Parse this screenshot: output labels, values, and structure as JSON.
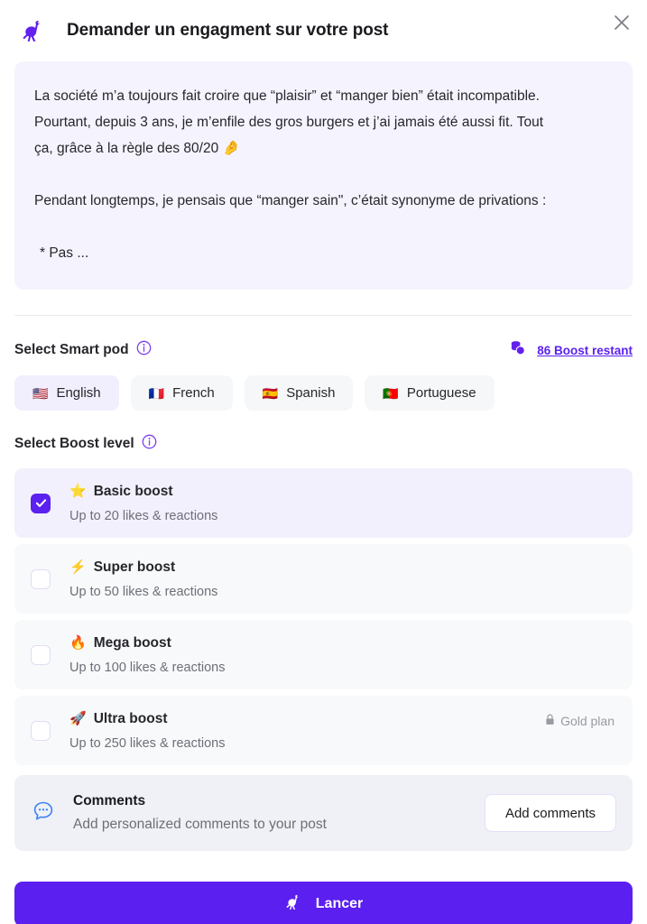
{
  "header": {
    "logo_icon": "ostrich-logo",
    "title": "Demander un engagment sur votre post",
    "close_icon": "close-icon"
  },
  "post_preview": {
    "paragraph_1_line_1": "La société m’a toujours fait croire que “plaisir” et “manger bien” était incompatible.",
    "paragraph_1_line_2": "Pourtant, depuis 3 ans, je m’enfile des gros burgers et j’ai jamais été aussi fit. Tout",
    "paragraph_1_line_3": "ça, grâce à la règle des 80/20 🤌",
    "paragraph_2": "Pendant longtemps, je pensais que “manger sain\", c’était synonyme de privations :",
    "bullet_1": "* Pas ..."
  },
  "smart_pod": {
    "title": "Select Smart pod",
    "info_icon": "info-icon",
    "coins_icon": "coins-icon",
    "boost_remaining": "86 Boost restant",
    "languages": [
      {
        "label": "English",
        "flag": "🇺🇸",
        "selected": true
      },
      {
        "label": "French",
        "flag": "🇫🇷",
        "selected": false
      },
      {
        "label": "Spanish",
        "flag": "🇪🇸",
        "selected": false
      },
      {
        "label": "Portuguese",
        "flag": "🇵🇹",
        "selected": false
      }
    ]
  },
  "boost_level": {
    "title": "Select Boost level",
    "info_icon": "info-icon",
    "options": [
      {
        "name": "Basic boost",
        "emoji": "⭐",
        "description": "Up to 20 likes & reactions",
        "selected": true,
        "plan_tag": ""
      },
      {
        "name": "Super boost",
        "emoji": "⚡",
        "description": "Up to 50 likes & reactions",
        "selected": false,
        "plan_tag": ""
      },
      {
        "name": "Mega boost",
        "emoji": "🔥",
        "description": "Up to 100 likes & reactions",
        "selected": false,
        "plan_tag": ""
      },
      {
        "name": "Ultra boost",
        "emoji": "🚀",
        "description": "Up to 250 likes & reactions",
        "selected": false,
        "plan_tag": "Gold plan",
        "plan_lock_icon": "lock-icon"
      }
    ]
  },
  "comments": {
    "icon": "comment-bubble-icon",
    "title": "Comments",
    "subtitle": "Add personalized comments to your post",
    "button_label": "Add comments"
  },
  "cta": {
    "icon": "ostrich-logo",
    "label": "Lancer"
  },
  "colors": {
    "accent": "#5b21f0",
    "cta_background": "#5b1ff0",
    "post_background": "#f5f3fd",
    "row_background": "#f8f9fa",
    "row_selected_background": "#f3f0fd",
    "comments_background": "#eff1f6",
    "muted_text": "#6e6e78"
  }
}
